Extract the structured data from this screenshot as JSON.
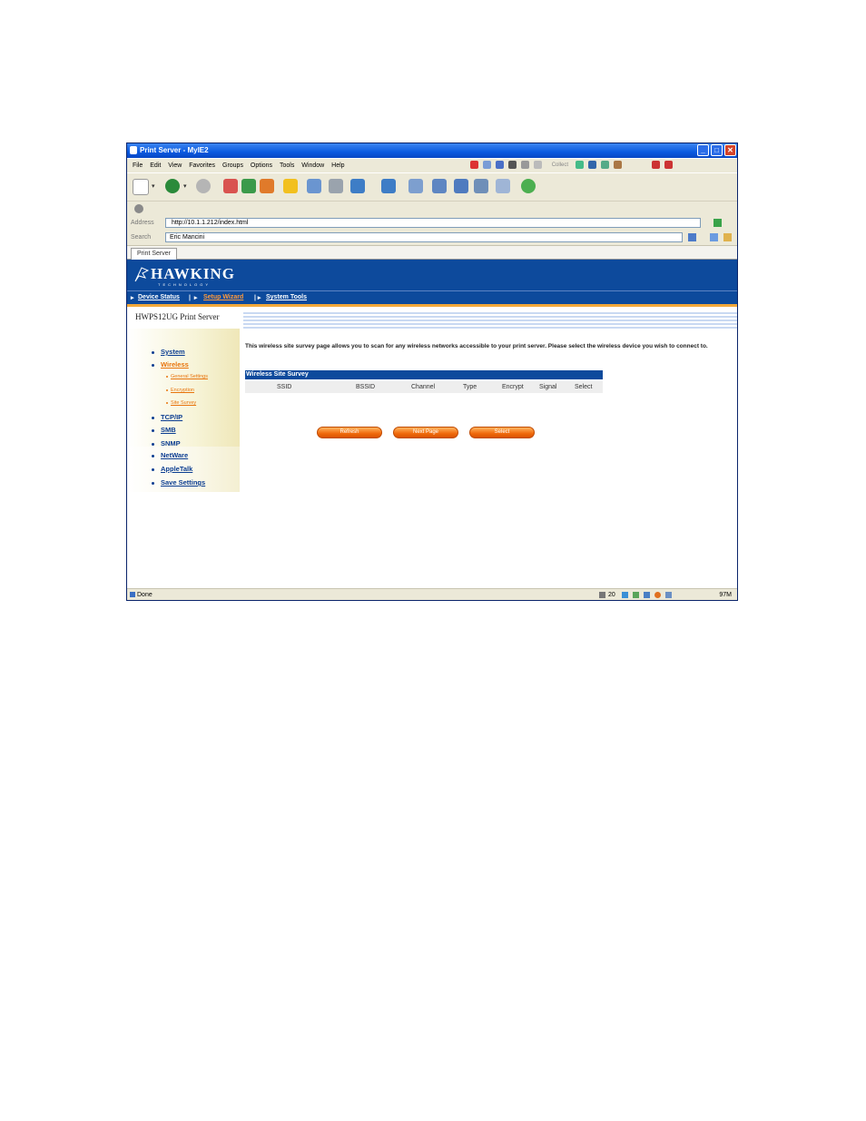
{
  "window": {
    "title": "Print Server - MyIE2",
    "controls": [
      "_",
      "□",
      "✕"
    ]
  },
  "menubar": {
    "items": [
      "File",
      "Edit",
      "View",
      "Favorites",
      "Groups",
      "Options",
      "Tools",
      "Window",
      "Help"
    ],
    "collect_label": "Collect"
  },
  "address": {
    "label": "Address",
    "url": "http://10.1.1.212/index.html"
  },
  "search": {
    "label": "Search",
    "value": "Eric Mancini"
  },
  "tabs": [
    "Print Server"
  ],
  "page": {
    "logo_main": "HAWKING",
    "logo_sub": "TECHNOLOGY",
    "nav": [
      "Device Status",
      "Setup Wizard",
      "System Tools"
    ],
    "device_name": "HWPS12UG Print Server",
    "sidebar": {
      "items": [
        "System",
        "Wireless",
        "TCP/IP",
        "SMB",
        "SNMP",
        "NetWare",
        "AppleTalk",
        "Save Settings"
      ],
      "wireless_sub": [
        "General Settings",
        "Encryption",
        "Site Survey"
      ]
    },
    "intro": "This wireless site survey page allows you to scan for any wireless networks accessible to your print server. Please select the wireless device you wish to connect to.",
    "survey_title": "Wireless Site Survey",
    "columns": [
      "SSID",
      "BSSID",
      "Channel",
      "Type",
      "Encrypt",
      "Signal",
      "Select"
    ],
    "buttons": [
      "Refresh",
      "Next Page",
      "Select"
    ]
  },
  "status": {
    "text": "Done",
    "count": "20",
    "right": "97M"
  },
  "colors": {
    "banner": "#0d4a9c",
    "accent": "#f06a0c",
    "titlebar": "#0a5ae0"
  }
}
